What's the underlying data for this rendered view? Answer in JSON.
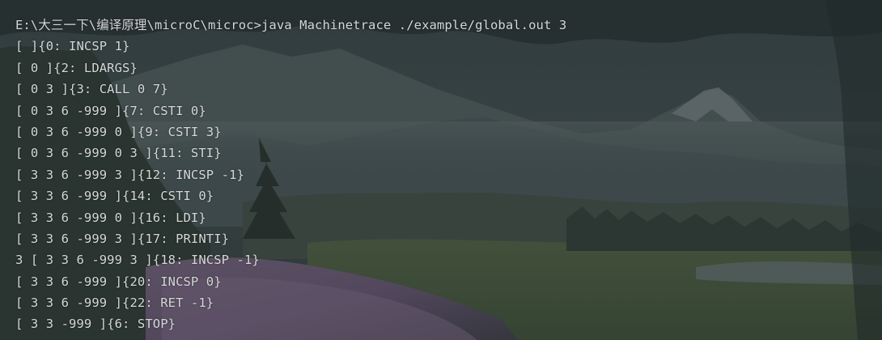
{
  "terminal": {
    "lines": [
      "E:\\大三一下\\编译原理\\microC\\microc>java Machinetrace ./example/global.out 3",
      "[ ]{0: INCSP 1}",
      "[ 0 ]{2: LDARGS}",
      "[ 0 3 ]{3: CALL 0 7}",
      "[ 0 3 6 -999 ]{7: CSTI 0}",
      "[ 0 3 6 -999 0 ]{9: CSTI 3}",
      "[ 0 3 6 -999 0 3 ]{11: STI}",
      "[ 3 3 6 -999 3 ]{12: INCSP -1}",
      "[ 3 3 6 -999 ]{14: CSTI 0}",
      "[ 3 3 6 -999 0 ]{16: LDI}",
      "[ 3 3 6 -999 3 ]{17: PRINTI}",
      "3 [ 3 3 6 -999 3 ]{18: INCSP -1}",
      "[ 3 3 6 -999 ]{20: INCSP 0}",
      "[ 3 3 6 -999 ]{22: RET -1}",
      "[ 3 3 -999 ]{6: STOP}"
    ]
  },
  "colors": {
    "text": "#d4d7d6",
    "background": "#2b3436"
  }
}
